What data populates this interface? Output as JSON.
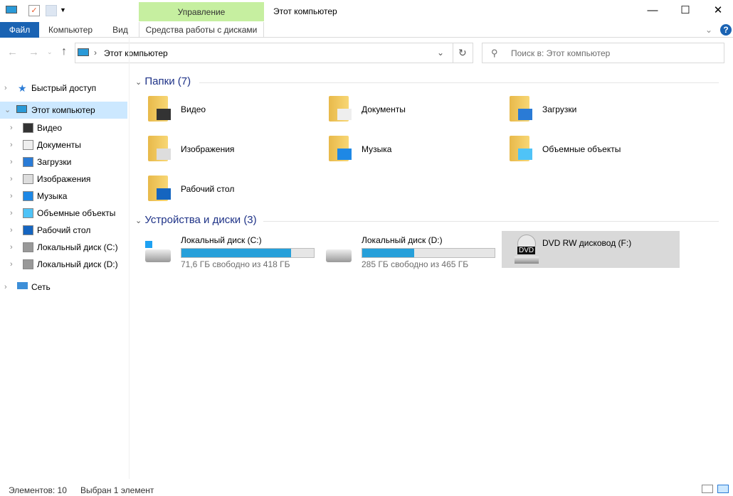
{
  "window": {
    "title": "Этот компьютер",
    "context_tab": "Управление",
    "minimize": "—",
    "maximize": "☐",
    "close": "✕"
  },
  "ribbon": {
    "tabs": [
      "Файл",
      "Компьютер",
      "Вид",
      "Средства работы с дисками"
    ]
  },
  "address": {
    "path": "Этот компьютер",
    "search_placeholder": "Поиск в: Этот компьютер"
  },
  "nav": {
    "quick": "Быстрый доступ",
    "pc": "Этот компьютер",
    "children": [
      "Видео",
      "Документы",
      "Загрузки",
      "Изображения",
      "Музыка",
      "Объемные объекты",
      "Рабочий стол",
      "Локальный диск (C:)",
      "Локальный диск (D:)"
    ],
    "network": "Сеть"
  },
  "folders": {
    "header": "Папки (7)",
    "items": [
      "Видео",
      "Документы",
      "Загрузки",
      "Изображения",
      "Музыка",
      "Объемные объекты",
      "Рабочий стол"
    ]
  },
  "drives": {
    "header": "Устройства и диски (3)",
    "items": [
      {
        "name": "Локальный диск (C:)",
        "free": "71,6 ГБ свободно из 418 ГБ",
        "used_fraction": 0.83
      },
      {
        "name": "Локальный диск (D:)",
        "free": "285 ГБ свободно из 465 ГБ",
        "used_fraction": 0.39
      },
      {
        "name": "DVD RW дисковод (F:)",
        "badge": "DVD"
      }
    ]
  },
  "status": {
    "count": "Элементов: 10",
    "selected": "Выбран 1 элемент"
  },
  "colors": {
    "accent": "#1a63b3",
    "bar": "#26a0da",
    "context": "#c6efa0"
  }
}
